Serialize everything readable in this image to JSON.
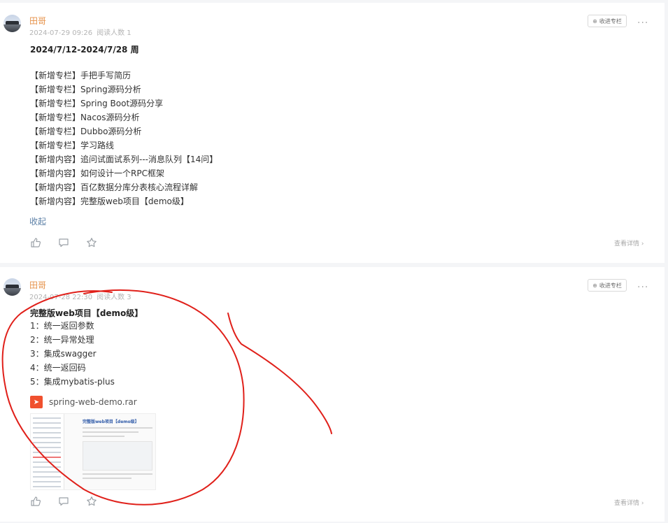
{
  "posts": [
    {
      "author": "田哥",
      "date": "2024-07-29 09:26",
      "reads": "阅读人数 1",
      "collect_label": "收进专栏",
      "more_glyph": "···",
      "title": "2024/7/12-2024/7/28 周",
      "lines": [
        "【新增专栏】手把手写简历",
        "【新增专栏】Spring源码分析",
        "【新增专栏】Spring Boot源码分享",
        "【新增专栏】Nacos源码分析",
        "【新增专栏】Dubbo源码分析",
        "【新增专栏】学习路线",
        "【新增内容】追问试面试系列---消息队列【14问】",
        "【新增内容】如何设计一个RPC框架",
        "【新增内容】百亿数据分库分表核心流程详解",
        "【新增内容】完整版web项目【demo级】"
      ],
      "collapse_label": "收起",
      "detail_label": "查看详情 ›"
    },
    {
      "author": "田哥",
      "date": "2024-07-28 22:30",
      "reads": "阅读人数 3",
      "collect_label": "收进专栏",
      "more_glyph": "···",
      "title": "完整版web项目【demo级】",
      "lines": [
        "1：统一返回参数",
        "2：统一异常处理",
        "3：集成swagger",
        "4：统一返回码",
        "5：集成mybatis-plus"
      ],
      "attachment": "spring-web-demo.rar",
      "thumbnail_heading": "完整版web项目【demo级】",
      "detail_label": "查看详情 ›"
    }
  ],
  "colors": {
    "author": "#e6924a",
    "link": "#5b7fa6",
    "annotation": "#e0201a",
    "attachment_icon": "#f0502e"
  },
  "icons": [
    "like-icon",
    "comment-icon",
    "star-icon",
    "collect-icon",
    "more-icon",
    "pdf-file-icon"
  ]
}
